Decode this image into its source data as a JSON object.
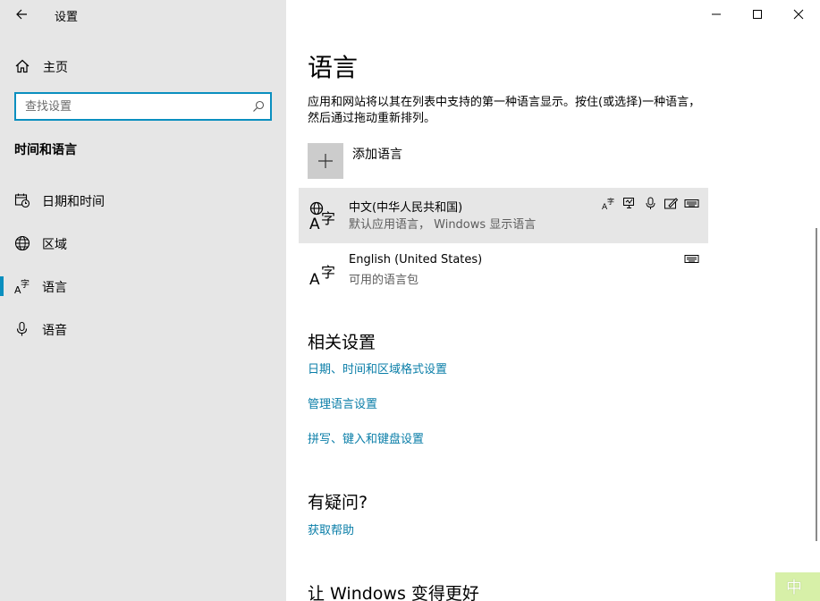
{
  "window": {
    "app_title": "设置",
    "back_icon": "back-arrow-icon",
    "minimize_icon": "minimize-icon",
    "maximize_icon": "maximize-icon",
    "close_icon": "close-icon"
  },
  "sidebar": {
    "home_label": "主页",
    "search_placeholder": "查找设置",
    "section_title": "时间和语言",
    "items": [
      {
        "label": "日期和时间",
        "icon": "calendar-clock-icon"
      },
      {
        "label": "区域",
        "icon": "globe-icon"
      },
      {
        "label": "语言",
        "icon": "language-icon",
        "active": true
      },
      {
        "label": "语音",
        "icon": "microphone-icon"
      }
    ]
  },
  "main": {
    "title": "语言",
    "description": "应用和网站将以其在列表中支持的第一种语言显示。按住(或选择)一种语言，然后通过拖动重新排列。",
    "add_language_label": "添加语言",
    "languages": [
      {
        "name": "中文(中华人民共和国)",
        "sub": "默认应用语言， Windows 显示语言",
        "selected": true
      },
      {
        "name": "English (United States)",
        "sub": "可用的语言包",
        "selected": false
      }
    ],
    "related_title": "相关设置",
    "related_links": [
      "日期、时间和区域格式设置",
      "管理语言设置",
      "拼写、键入和键盘设置"
    ],
    "question_title": "有疑问?",
    "help_link": "获取帮助",
    "improve_title": "让 Windows 变得更好"
  },
  "ime": {
    "label": "中"
  },
  "colors": {
    "accent": "#0a8fbf",
    "link": "#0a7ea8",
    "sidebar_bg": "#e6e6e6"
  }
}
